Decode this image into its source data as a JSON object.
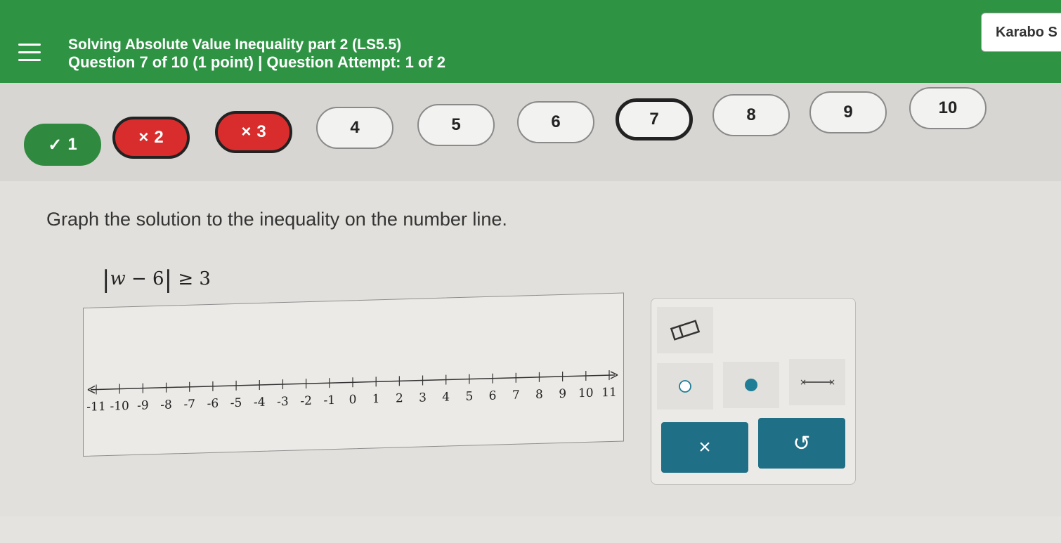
{
  "header": {
    "course_title": "Solving Absolute Value Inequality part 2 (LS5.5)",
    "question_info": "Question 7 of 10 (1 point)  |  Question Attempt: 1 of 2",
    "user_name": "Karabo S"
  },
  "question_nav": [
    {
      "label": "1",
      "status": "correct",
      "mark": "✓"
    },
    {
      "label": "2",
      "status": "wrong",
      "mark": "×"
    },
    {
      "label": "3",
      "status": "wrong",
      "mark": "×"
    },
    {
      "label": "4",
      "status": "unanswered",
      "mark": ""
    },
    {
      "label": "5",
      "status": "unanswered",
      "mark": ""
    },
    {
      "label": "6",
      "status": "unanswered",
      "mark": ""
    },
    {
      "label": "7",
      "status": "current",
      "mark": ""
    },
    {
      "label": "8",
      "status": "unanswered",
      "mark": ""
    },
    {
      "label": "9",
      "status": "unanswered",
      "mark": ""
    },
    {
      "label": "10",
      "status": "unanswered",
      "mark": ""
    }
  ],
  "question": {
    "prompt": "Graph the solution to the inequality on the number line.",
    "variable": "w",
    "minus": " − 6",
    "rhs": " ≥ 3"
  },
  "number_line": {
    "min": -11,
    "max": 11,
    "ticks": [
      "-11",
      "-10",
      "-9",
      "-8",
      "-7",
      "-6",
      "-5",
      "-4",
      "-3",
      "-2",
      "-1",
      "0",
      "1",
      "2",
      "3",
      "4",
      "5",
      "6",
      "7",
      "8",
      "9",
      "10",
      "11"
    ]
  },
  "tools": {
    "eraser": "eraser-icon",
    "open_point": "open-circle-icon",
    "closed_point": "closed-circle-icon",
    "segment": "segment-icon",
    "clear_label": "×",
    "undo_label": "↺"
  },
  "colors": {
    "header_green": "#2e9444",
    "correct_green": "#2f8a3f",
    "wrong_red": "#d92d2d",
    "button_teal": "#1f6f86",
    "point_teal": "#1f7e96"
  }
}
